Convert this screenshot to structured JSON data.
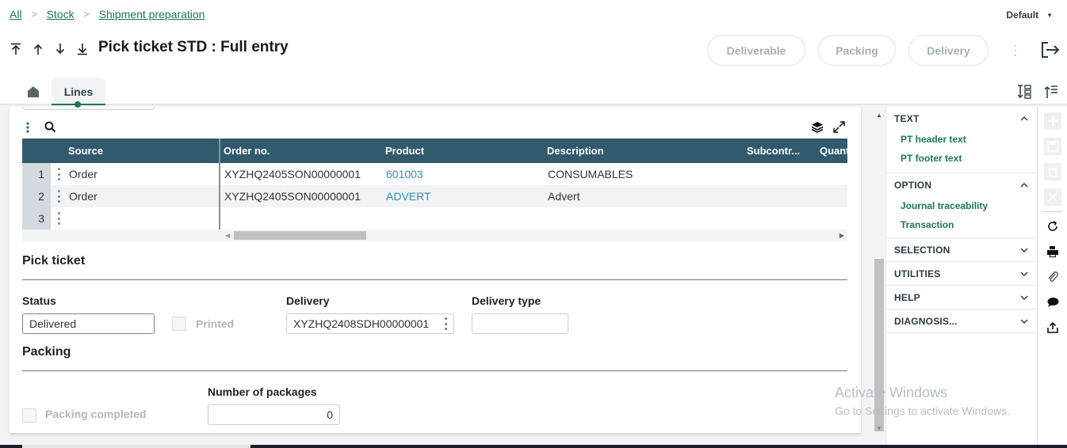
{
  "breadcrumb": [
    "All",
    "Stock",
    "Shipment preparation"
  ],
  "profile_selector": {
    "value": "Default"
  },
  "page_title": "Pick ticket STD : Full entry",
  "actions": [
    "Deliverable",
    "Packing",
    "Delivery"
  ],
  "tabs": [
    {
      "name": "home",
      "icon": "home-icon"
    },
    {
      "name": "Lines",
      "label": "Lines",
      "active": true
    }
  ],
  "grid": {
    "columns": [
      "Source",
      "Order no.",
      "Product",
      "Description",
      "Subcontr...",
      "Quant"
    ],
    "rows": [
      {
        "num": "1",
        "source": "Order",
        "order_no": "XYZHQ2405SON00000001",
        "product": "601003",
        "description": "CONSUMABLES",
        "subcontract": "",
        "quantity": ""
      },
      {
        "num": "2",
        "source": "Order",
        "order_no": "XYZHQ2405SON00000001",
        "product": "ADVERT",
        "description": "Advert",
        "subcontract": "",
        "quantity": ""
      },
      {
        "num": "3",
        "source": "",
        "order_no": "",
        "product": "",
        "description": "",
        "subcontract": "",
        "quantity": ""
      }
    ]
  },
  "pick_ticket": {
    "title": "Pick ticket",
    "status_label": "Status",
    "status_value": "Delivered",
    "printed_label": "Printed",
    "printed_checked": false,
    "delivery_label": "Delivery",
    "delivery_value": "XYZHQ2408SDH00000001",
    "delivery_type_label": "Delivery type",
    "delivery_type_value": ""
  },
  "packing": {
    "title": "Packing",
    "completed_label": "Packing completed",
    "completed_checked": false,
    "packages_label": "Number of packages",
    "packages_value": "0"
  },
  "side_panel": {
    "sections": [
      {
        "title": "TEXT",
        "expanded": true,
        "items": [
          "PT header text",
          "PT footer text"
        ]
      },
      {
        "title": "OPTION",
        "expanded": true,
        "items": [
          "Journal traceability",
          "Transaction"
        ]
      },
      {
        "title": "SELECTION",
        "expanded": false,
        "items": []
      },
      {
        "title": "UTILITIES",
        "expanded": false,
        "items": []
      },
      {
        "title": "HELP",
        "expanded": false,
        "items": []
      },
      {
        "title": "DIAGNOSIS...",
        "expanded": false,
        "items": []
      }
    ]
  },
  "icon_bar": [
    "plus-icon",
    "save-icon",
    "trash-icon",
    "close-icon",
    "refresh-icon",
    "print-icon",
    "paperclip-icon",
    "comment-icon",
    "share-icon"
  ],
  "watermark": {
    "line1": "Activate Windows",
    "line2": "Go to Settings to activate Windows."
  },
  "colors": {
    "accent": "#1b7a4c",
    "header_bg": "#325a6e",
    "link": "#2f8fb9"
  }
}
